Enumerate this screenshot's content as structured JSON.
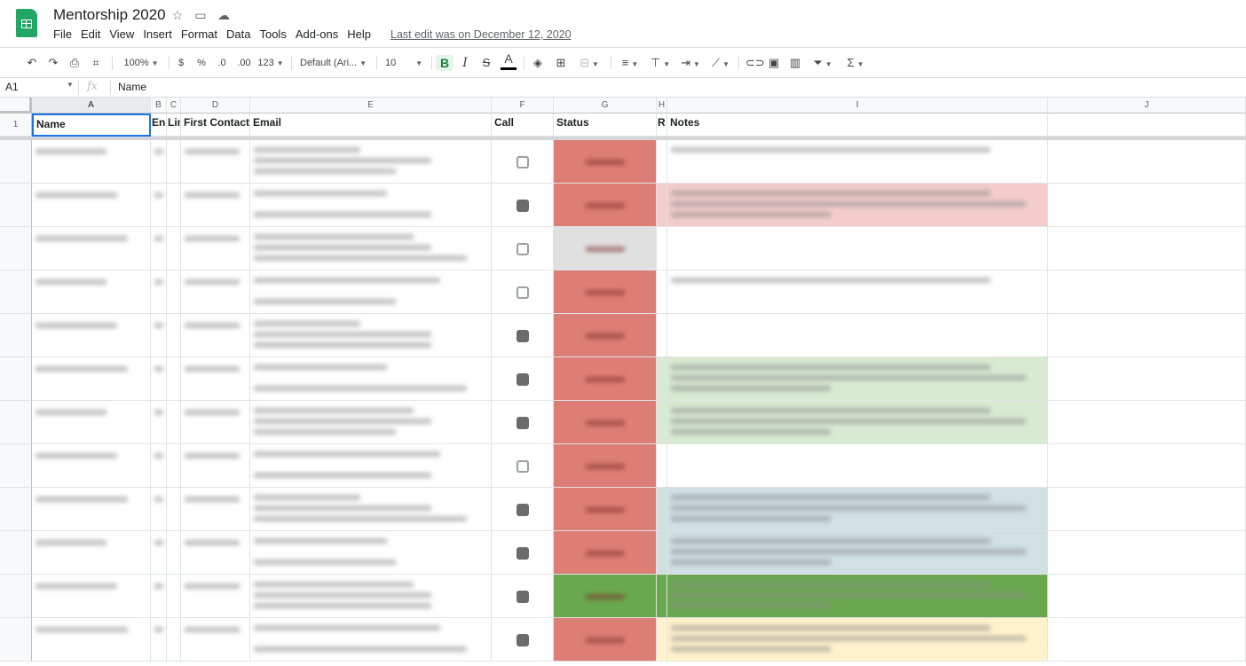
{
  "app": {
    "title": "Mentorship 2020",
    "last_edit": "Last edit was on December 12, 2020",
    "menu": [
      "File",
      "Edit",
      "View",
      "Insert",
      "Format",
      "Data",
      "Tools",
      "Add-ons",
      "Help"
    ]
  },
  "toolbar": {
    "zoom": "100%",
    "currency": "$",
    "percent": "%",
    "dec_decrease": ".0",
    "dec_increase": ".00",
    "more_formats": "123",
    "font": "Default (Ari...",
    "font_size": "10",
    "bold": "B",
    "italic": "I",
    "strike": "S",
    "text_color": "A"
  },
  "formula_bar": {
    "cell_ref": "A1",
    "fx": "fx",
    "content": "Name"
  },
  "grid": {
    "columns": [
      "A",
      "B",
      "C",
      "D",
      "E",
      "F",
      "G",
      "H",
      "I",
      "J"
    ],
    "header_row_number": "1",
    "headers": {
      "A": "Name",
      "B": "En",
      "C": "Lir",
      "D": "First Contact",
      "E": "Email",
      "F": "Call",
      "G": "Status",
      "H": "R",
      "I": "Notes"
    },
    "rows": [
      {
        "status_color": "#dd7e76",
        "check": false,
        "notes_color": "#ffffff"
      },
      {
        "status_color": "#dd7e76",
        "check": true,
        "notes_color": "#f4cccc"
      },
      {
        "status_color": "#e0e0e0",
        "check": false,
        "notes_color": "#ffffff"
      },
      {
        "status_color": "#dd7e76",
        "check": false,
        "notes_color": "#ffffff"
      },
      {
        "status_color": "#dd7e76",
        "check": true,
        "notes_color": "#ffffff"
      },
      {
        "status_color": "#dd7e76",
        "check": true,
        "notes_color": "#d9ead3"
      },
      {
        "status_color": "#dd7e76",
        "check": true,
        "notes_color": "#d9ead3"
      },
      {
        "status_color": "#dd7e76",
        "check": false,
        "notes_color": "#ffffff"
      },
      {
        "status_color": "#dd7e76",
        "check": true,
        "notes_color": "#d0e0e3"
      },
      {
        "status_color": "#dd7e76",
        "check": true,
        "notes_color": "#d0e0e3"
      },
      {
        "status_color": "#6aa84f",
        "check": true,
        "notes_color": "#6aa84f"
      },
      {
        "status_color": "#dd7e76",
        "check": true,
        "notes_color": "#fff2cc"
      }
    ]
  },
  "colors": {
    "selection": "#1a73e8",
    "sheets_green": "#23a566"
  }
}
